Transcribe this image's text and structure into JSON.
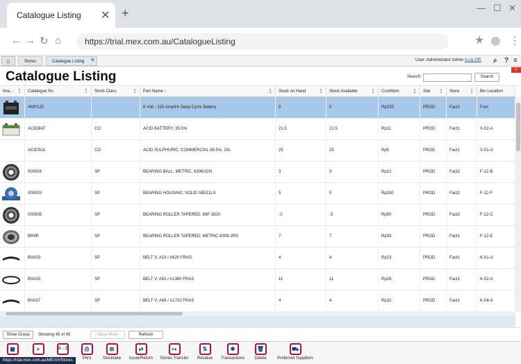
{
  "browser": {
    "tab_title": "Catalogue Listing",
    "url": "https://trial.mex.com.au/CatalogueListing"
  },
  "breadcrumb": {
    "items": [
      "Stores",
      "Catalogue Listing"
    ]
  },
  "user": {
    "label": "User: Administrator Admin",
    "logoff": "(Log Off)"
  },
  "page": {
    "title": "Catalogue Listing",
    "search_label": "Search:",
    "search_placeholder": "",
    "search_button": "Search"
  },
  "columns": [
    "Ima...",
    "Catalogue No",
    "Stock Class",
    "Part Name ↑",
    "Stock on Hand",
    "Stock Available",
    "Cost/Item",
    "Site",
    "Store",
    "Bin Location"
  ],
  "rows": [
    {
      "catalogue_no": "AMP125",
      "stock_class": "",
      "part_name": "6 Volt - 125 Amp/Hr Deep Cycle Battery",
      "on_hand": "0",
      "available": "0",
      "cost": "Rp235",
      "site": "PROD",
      "store": "Fact1",
      "bin": "Foor",
      "image": "battery-black"
    },
    {
      "catalogue_no": "ACIDBAT",
      "stock_class": "CO",
      "part_name": "ACID BATTERY; 35.5%",
      "on_hand": "21.5",
      "available": "21.5",
      "cost": "Rp11",
      "site": "PROD",
      "store": "Fact1",
      "bin": "X-02-A",
      "image": "battery-white"
    },
    {
      "catalogue_no": "ACIDSUL",
      "stock_class": "CO",
      "part_name": "ACID SULPHURIC; COMMERCIAL 98.5%, 20L",
      "on_hand": "25",
      "available": "25",
      "cost": "Rp5",
      "site": "PROD",
      "store": "Fact1",
      "bin": "X-01-A",
      "image": "none"
    },
    {
      "catalogue_no": "000004",
      "stock_class": "SP",
      "part_name": "BEARING BALL; METRIC, 6306/32N",
      "on_hand": "3",
      "available": "3",
      "cost": "Rp12",
      "site": "PROD",
      "store": "Fact2",
      "bin": "F-12-B",
      "image": "bearing"
    },
    {
      "catalogue_no": "000003",
      "stock_class": "SP",
      "part_name": "BEARING HOUSING; SOLID SB511LS",
      "on_hand": "5",
      "available": "5",
      "cost": "Rp330",
      "site": "PROD",
      "store": "Fact2",
      "bin": "F-12-F",
      "image": "housing"
    },
    {
      "catalogue_no": "000005",
      "stock_class": "SP",
      "part_name": "BEARING ROLLER TAPERED; IMP 3920",
      "on_hand": "-3",
      "available": "-3",
      "cost": "Rp50",
      "site": "PROD",
      "store": "Fact2",
      "bin": "F-12-C",
      "image": "bearing"
    },
    {
      "catalogue_no": "BR4R",
      "stock_class": "SP",
      "part_name": "BEARING ROLLER TAPERED; METRIC 6308-2RS",
      "on_hand": "7",
      "available": "7",
      "cost": "Rp33",
      "site": "PROD",
      "store": "Fact1",
      "bin": "F-12-E",
      "image": "roller"
    },
    {
      "catalogue_no": "BVA03",
      "stock_class": "SP",
      "part_name": "BELT V; A23 / A620 FRAS",
      "on_hand": "4",
      "available": "4",
      "cost": "Rp13",
      "site": "PROD",
      "store": "Fact1",
      "bin": "K-01-A",
      "image": "belt-flat"
    },
    {
      "catalogue_no": "BVA33",
      "stock_class": "SP",
      "part_name": "BELT V; A52 / A1360 FRAS",
      "on_hand": "11",
      "available": "11",
      "cost": "Rp28",
      "site": "PROD",
      "store": "Fact1",
      "bin": "K-02-A",
      "image": "belt-loop"
    },
    {
      "catalogue_no": "BVA37",
      "stock_class": "SP",
      "part_name": "BELT V; A66 / A1710 FRAS",
      "on_hand": "4",
      "available": "4",
      "cost": "Rp32",
      "site": "PROD",
      "store": "Fact1",
      "bin": "K-04-A",
      "image": "belt-flat"
    }
  ],
  "footer": {
    "show_group": "Show Group",
    "showing": "Showing 45 of 45",
    "show_more": "Show More",
    "refresh": "Refresh"
  },
  "actions": [
    "Print",
    "Stocktake",
    "Issue/Return",
    "Stores Transfer",
    "Revalue",
    "Transactions",
    "Delete",
    "Preferred Suppliers"
  ],
  "status_url": "https://trial.mex.com.au/MEX/#/Stores",
  "colors": {
    "selected_row": "#a8c8ea",
    "negative": "#dd2222",
    "action_border": "#b0103a"
  }
}
